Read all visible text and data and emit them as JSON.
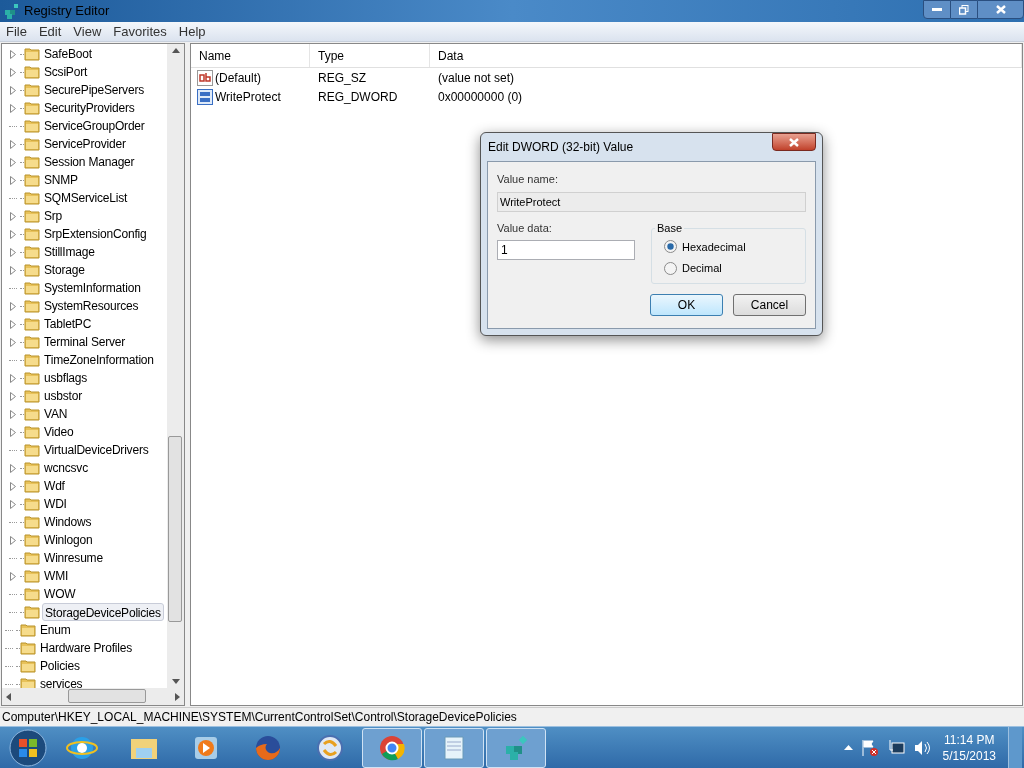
{
  "window": {
    "title": "Registry Editor"
  },
  "menu": [
    "File",
    "Edit",
    "View",
    "Favorites",
    "Help"
  ],
  "tree": [
    {
      "children": [
        {
          "label": "SafeBoot",
          "expandable": true,
          "selected": false
        },
        {
          "label": "ScsiPort",
          "expandable": true,
          "selected": false
        },
        {
          "label": "SecurePipeServers",
          "expandable": true,
          "selected": false
        },
        {
          "label": "SecurityProviders",
          "expandable": true,
          "selected": false
        },
        {
          "label": "ServiceGroupOrder",
          "expandable": false,
          "selected": false
        },
        {
          "label": "ServiceProvider",
          "expandable": true,
          "selected": false
        },
        {
          "label": "Session Manager",
          "expandable": true,
          "selected": false
        },
        {
          "label": "SNMP",
          "expandable": true,
          "selected": false
        },
        {
          "label": "SQMServiceList",
          "expandable": false,
          "selected": false
        },
        {
          "label": "Srp",
          "expandable": true,
          "selected": false
        },
        {
          "label": "SrpExtensionConfig",
          "expandable": true,
          "selected": false
        },
        {
          "label": "StillImage",
          "expandable": true,
          "selected": false
        },
        {
          "label": "Storage",
          "expandable": true,
          "selected": false
        },
        {
          "label": "SystemInformation",
          "expandable": false,
          "selected": false
        },
        {
          "label": "SystemResources",
          "expandable": true,
          "selected": false
        },
        {
          "label": "TabletPC",
          "expandable": true,
          "selected": false
        },
        {
          "label": "Terminal Server",
          "expandable": true,
          "selected": false
        },
        {
          "label": "TimeZoneInformation",
          "expandable": false,
          "selected": false
        },
        {
          "label": "usbflags",
          "expandable": true,
          "selected": false
        },
        {
          "label": "usbstor",
          "expandable": true,
          "selected": false
        },
        {
          "label": "VAN",
          "expandable": true,
          "selected": false
        },
        {
          "label": "Video",
          "expandable": true,
          "selected": false
        },
        {
          "label": "VirtualDeviceDrivers",
          "expandable": false,
          "selected": false
        },
        {
          "label": "wcncsvc",
          "expandable": true,
          "selected": false
        },
        {
          "label": "Wdf",
          "expandable": true,
          "selected": false
        },
        {
          "label": "WDI",
          "expandable": true,
          "selected": false
        },
        {
          "label": "Windows",
          "expandable": false,
          "selected": false
        },
        {
          "label": "Winlogon",
          "expandable": true,
          "selected": false
        },
        {
          "label": "Winresume",
          "expandable": false,
          "selected": false
        },
        {
          "label": "WMI",
          "expandable": true,
          "selected": false
        },
        {
          "label": "WOW",
          "expandable": false,
          "selected": false
        },
        {
          "label": "StorageDevicePolicies",
          "expandable": false,
          "selected": true
        }
      ]
    },
    {
      "label": "Enum",
      "expandable": false,
      "selected": false
    },
    {
      "label": "Hardware Profiles",
      "expandable": false,
      "selected": false
    },
    {
      "label": "Policies",
      "expandable": false,
      "selected": false
    },
    {
      "label": "services",
      "expandable": false,
      "selected": false
    }
  ],
  "values": {
    "columns": [
      "Name",
      "Type",
      "Data"
    ],
    "rows": [
      {
        "kind": "string",
        "name": "(Default)",
        "type": "REG_SZ",
        "data": "(value not set)"
      },
      {
        "kind": "binary",
        "name": "WriteProtect",
        "type": "REG_DWORD",
        "data": "0x00000000 (0)"
      }
    ]
  },
  "dialog": {
    "title": "Edit DWORD (32-bit) Value",
    "value_name_label": "Value name:",
    "value_name": "WriteProtect",
    "value_data_label": "Value data:",
    "value_data": "1",
    "base_label": "Base",
    "bases": [
      {
        "label": "Hexadecimal",
        "selected": true
      },
      {
        "label": "Decimal",
        "selected": false
      }
    ],
    "buttons": [
      {
        "label": "OK",
        "default": true
      },
      {
        "label": "Cancel",
        "default": false
      }
    ]
  },
  "status_bar": "Computer\\HKEY_LOCAL_MACHINE\\SYSTEM\\CurrentControlSet\\Control\\StorageDevicePolicies",
  "taskbar": {
    "apps": [
      {
        "kind": "ie",
        "open": false
      },
      {
        "kind": "explorer",
        "open": false
      },
      {
        "kind": "media",
        "open": false
      },
      {
        "kind": "firefox",
        "open": false
      },
      {
        "kind": "swirl",
        "open": false
      },
      {
        "kind": "chrome",
        "open": true
      },
      {
        "kind": "notepad",
        "open": true
      },
      {
        "kind": "regedit",
        "open": true
      }
    ],
    "time": "11:14 PM",
    "date": "5/15/2013"
  }
}
